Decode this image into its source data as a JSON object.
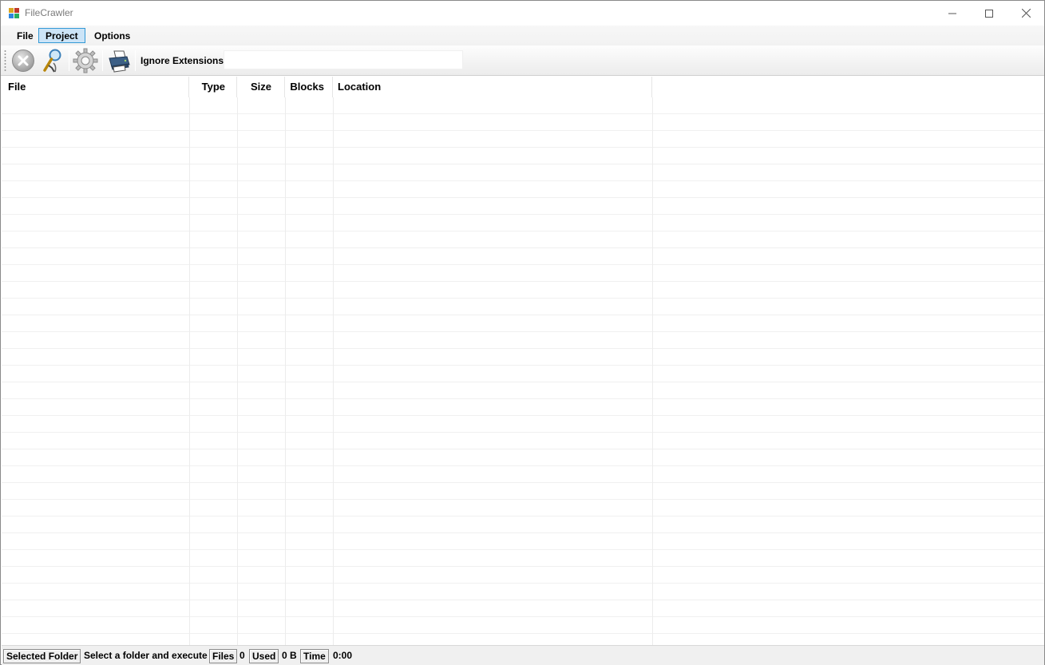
{
  "window": {
    "title": "FileCrawler"
  },
  "menu": {
    "items": [
      "File",
      "Project",
      "Options"
    ],
    "active": "Project"
  },
  "toolbar": {
    "buttons": [
      "stop-icon",
      "search-folder-icon",
      "settings-gear-icon",
      "print-icon"
    ],
    "ignore_extensions_label": "Ignore Extensions",
    "ignore_extensions_value": ""
  },
  "list": {
    "columns": [
      "File",
      "Type",
      "Size",
      "Blocks",
      "Location"
    ],
    "rows": []
  },
  "status": {
    "selected_folder_label": "Selected Folder",
    "selected_folder_value": "Select a folder and execute",
    "files_label": "Files",
    "files_value": "0",
    "used_label": "Used",
    "used_value": "0 B",
    "time_label": "Time",
    "time_value": "0:00"
  }
}
